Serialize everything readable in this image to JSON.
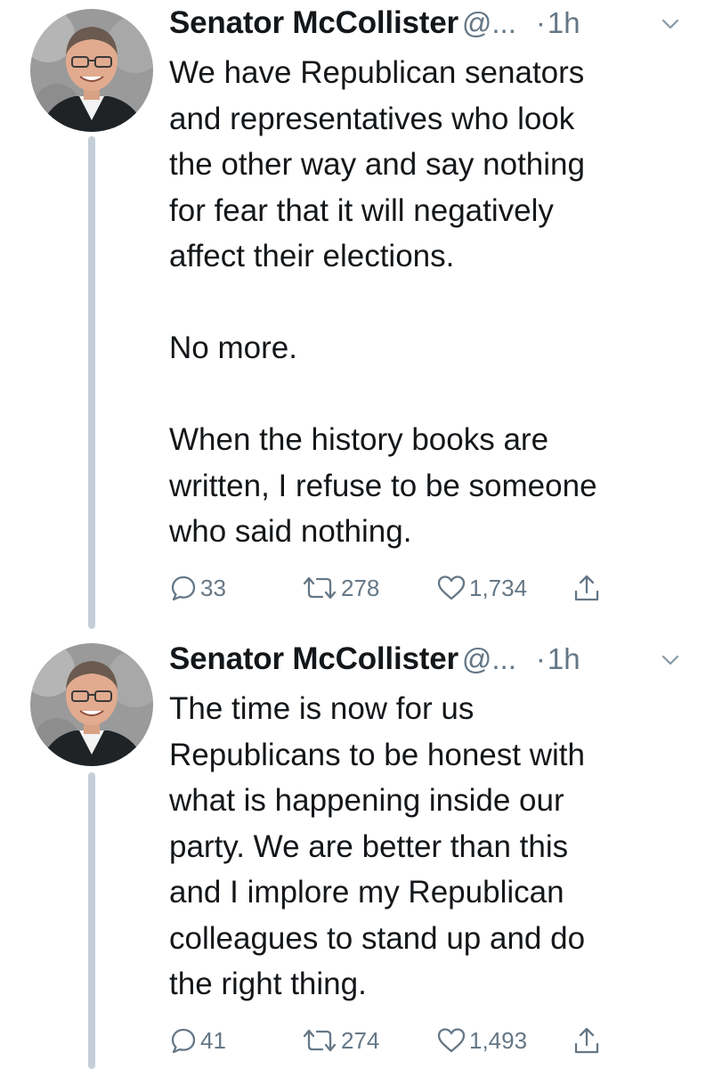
{
  "tweets": [
    {
      "author_name": "Senator McCollister",
      "handle": "@...",
      "separator": "·",
      "time": "1h",
      "text": "We have Republican senators\nand representatives who look\nthe other way and say nothing\nfor fear that it will negatively\naffect their elections.\n\nNo more.\n\nWhen the history books are\nwritten, I refuse to be someone\nwho said nothing.",
      "replies": "33",
      "retweets": "278",
      "likes": "1,734"
    },
    {
      "author_name": "Senator McCollister",
      "handle": "@...",
      "separator": "·",
      "time": "1h",
      "text": "The time is now for us\nRepublicans to be honest with\nwhat is happening inside our\nparty. We are better than this\nand I implore my Republican\ncolleagues to stand up and do\nthe right thing.",
      "replies": "41",
      "retweets": "274",
      "likes": "1,493"
    }
  ],
  "icons": {
    "reply": "speech-bubble",
    "retweet": "retweet-arrows",
    "like": "heart",
    "share": "share-upload",
    "menu": "chevron-down"
  },
  "colors": {
    "text": "#14171a",
    "secondary": "#657786",
    "thread_line": "#c4cfd8",
    "background": "#ffffff"
  }
}
